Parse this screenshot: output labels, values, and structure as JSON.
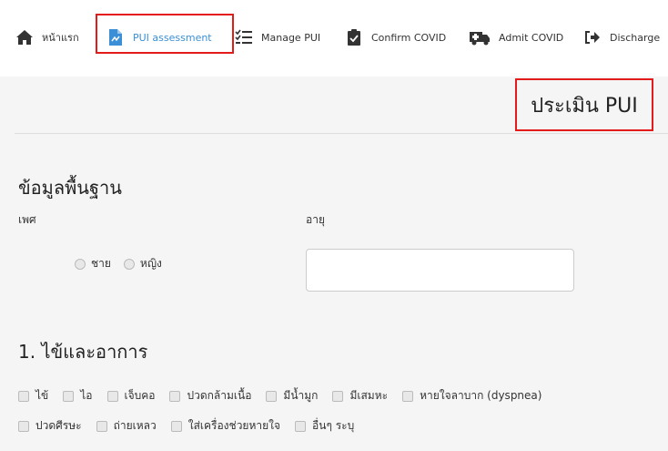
{
  "navbar": {
    "items": [
      {
        "label": "หน้าแรก",
        "icon": "home-icon"
      },
      {
        "label": "PUI assessment",
        "icon": "document-icon"
      },
      {
        "label": "Manage PUI",
        "icon": "checklist-icon"
      },
      {
        "label": "Confirm COVID",
        "icon": "clipboard-check-icon"
      },
      {
        "label": "Admit COVID",
        "icon": "ambulance-icon"
      },
      {
        "label": "Discharge",
        "icon": "sign-out-icon"
      }
    ],
    "active_color": "#3a8fd6",
    "highlight_color": "#e31b1b"
  },
  "main": {
    "page_title": "ประเมิน PUI",
    "basic_info": {
      "title": "ข้อมูลพื้นฐาน",
      "sex_label": "เพศ",
      "age_label": "อายุ",
      "sex_options": [
        "ชาย",
        "หญิง"
      ],
      "age_value": ""
    },
    "symptoms": {
      "title": "1. ไข้และอาการ",
      "row1": [
        "ไข้",
        "ไอ",
        "เจ็บคอ",
        "ปวดกล้ามเนื้อ",
        "มีน้ำมูก",
        "มีเสมหะ",
        "หายใจลาบาก (dyspnea)"
      ],
      "row2": [
        "ปวดศีรษะ",
        "ถ่ายเหลว",
        "ใส่เครื่องช่วยหายใจ",
        "อื่นๆ ระบุ"
      ]
    }
  }
}
